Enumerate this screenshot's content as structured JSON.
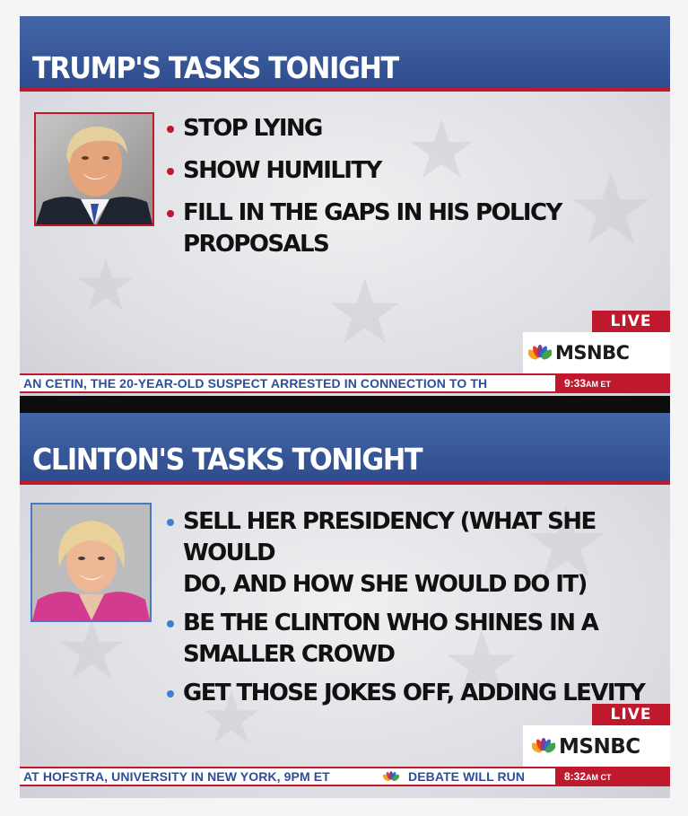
{
  "panels": {
    "trump": {
      "title": "TRUMP'S TASKS TONIGHT",
      "bullets": [
        "STOP LYING",
        "SHOW HUMILITY",
        "FILL IN THE GAPS IN HIS POLICY",
        "PROPOSALS"
      ],
      "live_label": "LIVE",
      "network": "MSNBC",
      "ticker": "AN CETIN, THE 20-YEAR-OLD SUSPECT ARRESTED IN CONNECTION TO TH",
      "time": "9:33",
      "time_suffix": "AM ET"
    },
    "clinton": {
      "title": "CLINTON'S TASKS TONIGHT",
      "bullets": [
        "SELL HER PRESIDENCY (WHAT SHE WOULD",
        "DO, AND HOW SHE WOULD DO IT)",
        "BE THE CLINTON WHO SHINES IN A",
        "SMALLER CROWD",
        "GET THOSE JOKES OFF, ADDING LEVITY"
      ],
      "live_label": "LIVE",
      "network": "MSNBC",
      "ticker_a": "AT HOFSTRA, UNIVERSITY IN NEW YORK, 9PM ET",
      "ticker_b": "DEBATE WILL RUN",
      "time": "8:32",
      "time_suffix": "AM CT"
    }
  },
  "colors": {
    "header_blue": "#2d4b8c",
    "accent_red": "#c0182c",
    "bullet_blue": "#3f7fd0",
    "ticker_text": "#2b4f9b"
  },
  "icons": [
    "nbc-peacock-icon",
    "bullet-dot-icon"
  ]
}
